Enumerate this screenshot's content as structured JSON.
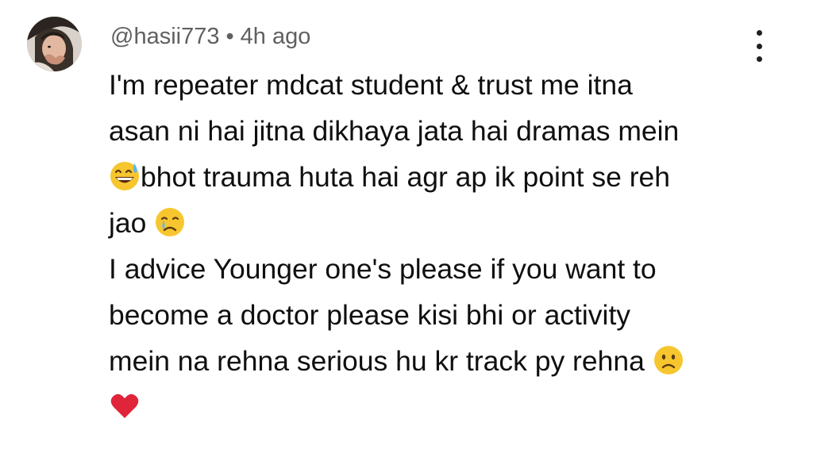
{
  "comment": {
    "author": "@hasii773",
    "separator": "•",
    "time": "4h ago",
    "lines": [
      "I'm repeater mdcat student & trust me itna",
      "asan ni hai jitna dikhaya jata hai dramas mein",
      "bhot trauma huta hai agr ap ik point se reh",
      "jao",
      "I advice Younger one's please if you want to",
      "become a doctor please kisi bhi or activity",
      "mein na rehna serious hu kr track py rehna"
    ],
    "emojis": {
      "line3_start": "grinning-sweat-emoji",
      "line4_end": "crying-face-emoji",
      "line7_end": "slightly-frowning-face-emoji",
      "last_line": "red-heart-emoji"
    }
  },
  "icons": {
    "menu": "more-vertical-icon",
    "avatar": "user-avatar"
  },
  "colors": {
    "background": "#ffffff",
    "text": "#0f0f0f",
    "meta_text": "#606060",
    "heart": "#e0243a",
    "emoji_yellow": "#f7c62f"
  }
}
